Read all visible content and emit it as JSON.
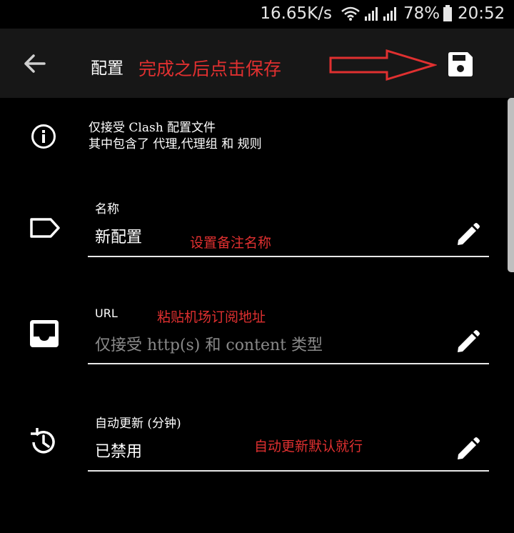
{
  "status_bar": {
    "speed": "16.65K/s",
    "battery": "78%",
    "time": "20:52"
  },
  "toolbar": {
    "title": "配置",
    "annotation": "完成之后点击保存"
  },
  "info": {
    "line1": "仅接受 Clash 配置文件",
    "line2": "其中包含了 代理,代理组 和 规则"
  },
  "fields": [
    {
      "label": "名称",
      "value": "新配置",
      "annotation": "设置备注名称"
    },
    {
      "label": "URL",
      "placeholder": "仅接受 http(s) 和 content 类型",
      "annotation": "粘贴机场订阅地址"
    },
    {
      "label": "自动更新 (分钟)",
      "value": "已禁用",
      "annotation": "自动更新默认就行"
    }
  ],
  "colors": {
    "background": "#000000",
    "toolbar": "#171717",
    "annotation": "#e03030",
    "text": "#ffffff",
    "placeholder": "#8a8a8a"
  },
  "icons": [
    "arrow-left-icon",
    "save-icon",
    "info-icon",
    "label-tag-icon",
    "inbox-icon",
    "history-clock-icon",
    "pencil-icon",
    "wifi-icon",
    "signal-icon",
    "battery-icon"
  ]
}
